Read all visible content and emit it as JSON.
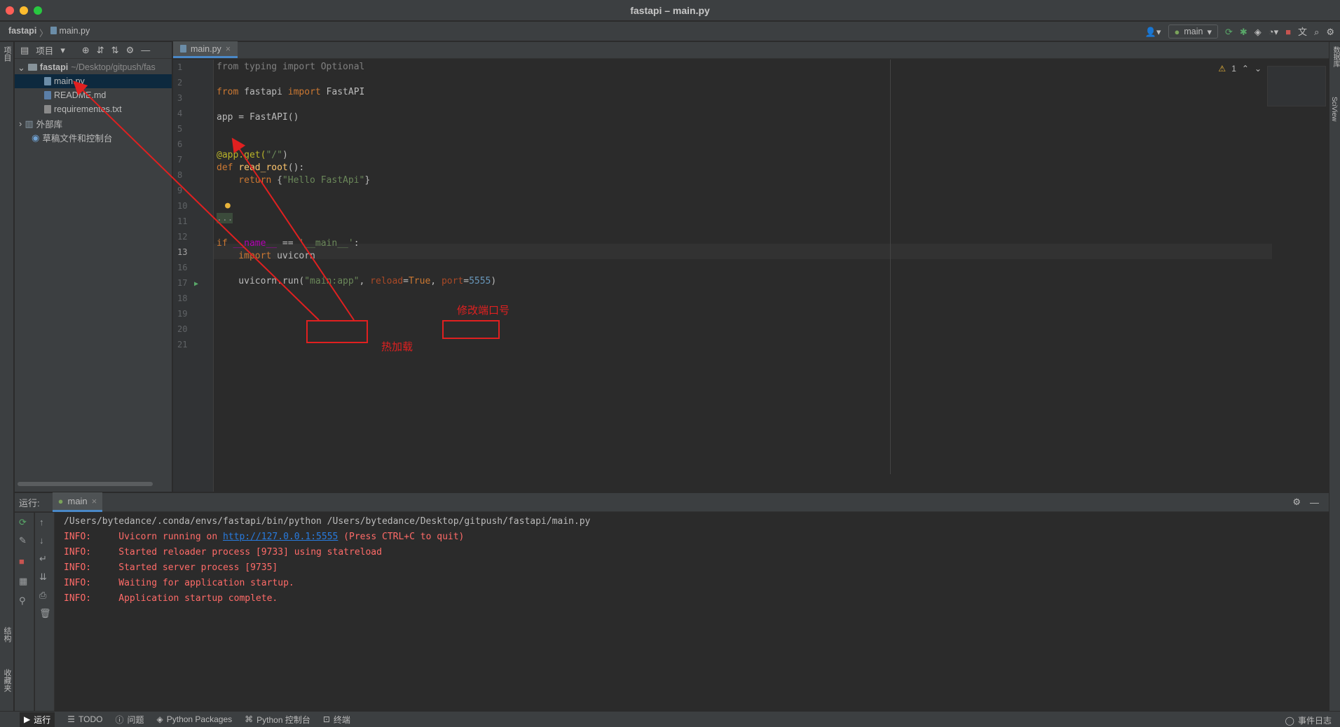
{
  "window": {
    "title": "fastapi – main.py"
  },
  "navbar": {
    "crumb_project": "fastapi",
    "crumb_sep": "〉",
    "crumb_file": "main.py",
    "run_config": "main"
  },
  "project": {
    "header_label": "项目",
    "root_name": "fastapi",
    "root_path": "~/Desktop/gitpush/fas",
    "files": [
      "main.py",
      "README.md",
      "requirementes.txt"
    ],
    "external_libs": "外部库",
    "scratches": "草稿文件和控制台"
  },
  "editor": {
    "tab_label": "main.py",
    "warning_count": "1",
    "line_numbers": [
      "1",
      "2",
      "3",
      "4",
      "5",
      "6",
      "7",
      "8",
      "9",
      "10",
      "11",
      "12",
      "13",
      "16",
      "17",
      "18",
      "19",
      "20",
      "21"
    ],
    "code": {
      "l1_a": "from",
      "l1_b": " typing ",
      "l1_c": "import",
      "l1_d": " Optional",
      "l3_a": "from",
      "l3_b": " fastapi ",
      "l3_c": "import",
      "l3_d": " FastAPI",
      "l5_a": "app",
      "l5_b": " = FastAPI()",
      "l8_a": "@app.get(",
      "l8_b": "\"/\"",
      "l8_c": ")",
      "l9_a": "def ",
      "l9_b": "read_root",
      "l9_c": "():",
      "l10_a": "    return ",
      "l10_b": "{",
      "l10_c": "\"Hello FastApi\"",
      "l10_d": "}",
      "l13": "...",
      "l17_a": "if ",
      "l17_b": "__name__",
      "l17_c": " == ",
      "l17_d": "'__main__'",
      "l17_e": ":",
      "l18_a": "    import ",
      "l18_b": "uvicorn",
      "l20_a": "    uvicorn.run(",
      "l20_b": "\"main:app\"",
      "l20_c": ", ",
      "l20_d": "reload",
      "l20_e": "=",
      "l20_f": "True",
      "l20_g": ", ",
      "l20_h": "port",
      "l20_i": "=",
      "l20_j": "5555",
      "l20_k": ")"
    }
  },
  "annotations": {
    "port_note": "修改端口号",
    "reload_note": "热加载"
  },
  "run_panel": {
    "label": "运行:",
    "tab": "main",
    "lines": [
      "/Users/bytedance/.conda/envs/fastapi/bin/python /Users/bytedance/Desktop/gitpush/fastapi/main.py",
      "INFO:     Uvicorn running on ",
      "http://127.0.0.1:5555",
      " (Press CTRL+C to quit)",
      "INFO:     Started reloader process [9733] using statreload",
      "INFO:     Started server process [9735]",
      "INFO:     Waiting for application startup.",
      "INFO:     Application startup complete."
    ]
  },
  "statusbar": {
    "items": [
      "运行",
      "TODO",
      "问题",
      "Python Packages",
      "Python 控制台",
      "终端"
    ],
    "event_log": "事件日志"
  },
  "side_labels": {
    "left_top": "项目",
    "left_mid": "结构",
    "left_bottom": "收藏夹",
    "right_top": "数据库",
    "right_mid": "SciView"
  },
  "colors": {
    "annotation": "#e02020",
    "accent": "#4a88c7",
    "console_info": "#ff6b68"
  }
}
